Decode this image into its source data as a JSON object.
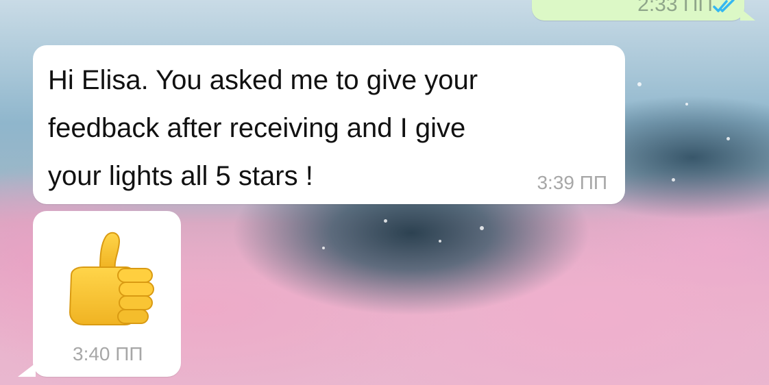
{
  "chat": {
    "wallpaper": "pink clouds over sea",
    "messages": [
      {
        "direction": "outgoing",
        "time": "2:33 ПП",
        "status_icon": "double-check-icon",
        "bubble_color": "#dcf8c6"
      },
      {
        "direction": "incoming",
        "text": "Hi Elisa. You asked me to give your\nfeedback after receiving and I give\nyour lights all 5 stars !",
        "time": "3:39 ПП",
        "bubble_color": "#ffffff"
      },
      {
        "direction": "incoming",
        "emoji": "thumbs-up-icon",
        "time": "3:40 ПП",
        "bubble_color": "#ffffff"
      }
    ]
  },
  "colors": {
    "read_ticks": "#34b7f1",
    "timestamp": "#a7a7a7",
    "emoji_yellow": "#f7c224"
  }
}
